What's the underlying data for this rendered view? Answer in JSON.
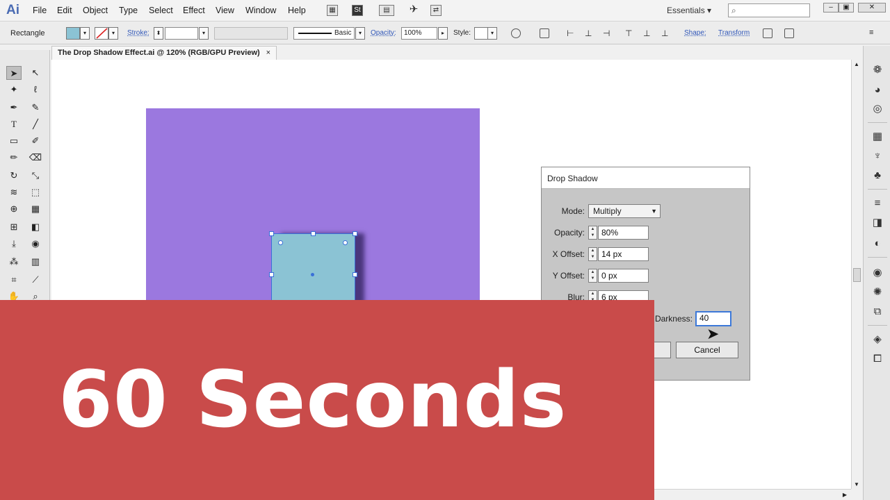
{
  "app": {
    "logo": "Ai"
  },
  "menu": [
    "File",
    "Edit",
    "Object",
    "Type",
    "Select",
    "Effect",
    "View",
    "Window",
    "Help"
  ],
  "workspace": "Essentials",
  "search": {
    "placeholder": "",
    "icon": "search-icon"
  },
  "window_controls": [
    "–",
    "▣",
    "✕"
  ],
  "control_bar": {
    "selection": "Rectangle",
    "stroke_label": "Stroke:",
    "brush_label": "Basic",
    "opacity_label": "Opacity:",
    "opacity_value": "100%",
    "style_label": "Style:",
    "shape_link": "Shape:",
    "transform_link": "Transform",
    "fill_color": "#8bc3d4"
  },
  "document_tab": {
    "title": "The Drop Shadow Effect.ai @ 120% (RGB/GPU Preview)",
    "close": "×"
  },
  "canvas": {
    "artboard_color": "#9b78df",
    "shape_color": "#8bc3d4"
  },
  "dialog": {
    "title": "Drop Shadow",
    "mode_label": "Mode:",
    "mode_value": "Multiply",
    "opacity_label": "Opacity:",
    "opacity_value": "80%",
    "x_offset_label": "X Offset:",
    "x_offset_value": "14 px",
    "y_offset_label": "Y Offset:",
    "y_offset_value": "0 px",
    "blur_label": "Blur:",
    "blur_value": "6 px",
    "darkness_label": "Darkness:",
    "darkness_value": "40",
    "cancel_label": "Cancel"
  },
  "banner": {
    "text": "60 Seconds",
    "color": "#c94b4a"
  }
}
